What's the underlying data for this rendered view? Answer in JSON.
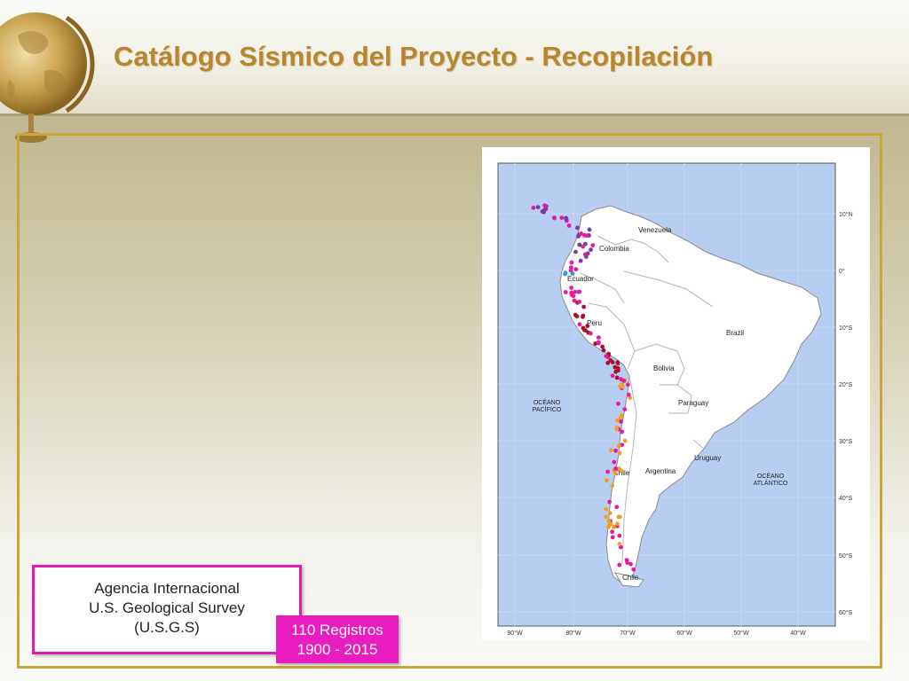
{
  "slide": {
    "title": "Catálogo Sísmico del Proyecto - Recopilación"
  },
  "source": {
    "line1": "Agencia Internacional",
    "line2": "U.S. Geological Survey",
    "line3": "(U.S.G.S)"
  },
  "records": {
    "count_label": "110 Registros",
    "period": "1900 - 2015"
  },
  "map": {
    "countries": [
      "Venezuela",
      "Colombia",
      "Ecuador",
      "Peru",
      "Brazil",
      "Bolivia",
      "Paraguay",
      "Uruguay",
      "Argentina",
      "Chile",
      "Chile"
    ],
    "ocean_pacific": [
      "OCÉANO",
      "PACÍFICO"
    ],
    "ocean_atlantic": [
      "OCÉANO",
      "ATLÁNTICO"
    ],
    "lat_labels": [
      "10°N",
      "0°",
      "10°S",
      "20°S",
      "30°S",
      "40°S",
      "50°S",
      "60°S"
    ],
    "lon_labels": [
      "90°W",
      "80°W",
      "70°W",
      "60°W",
      "50°W",
      "40°W"
    ],
    "colors": {
      "sea": "#b8cdf2",
      "land": "#ffffff",
      "border": "#9a9a9a"
    }
  }
}
